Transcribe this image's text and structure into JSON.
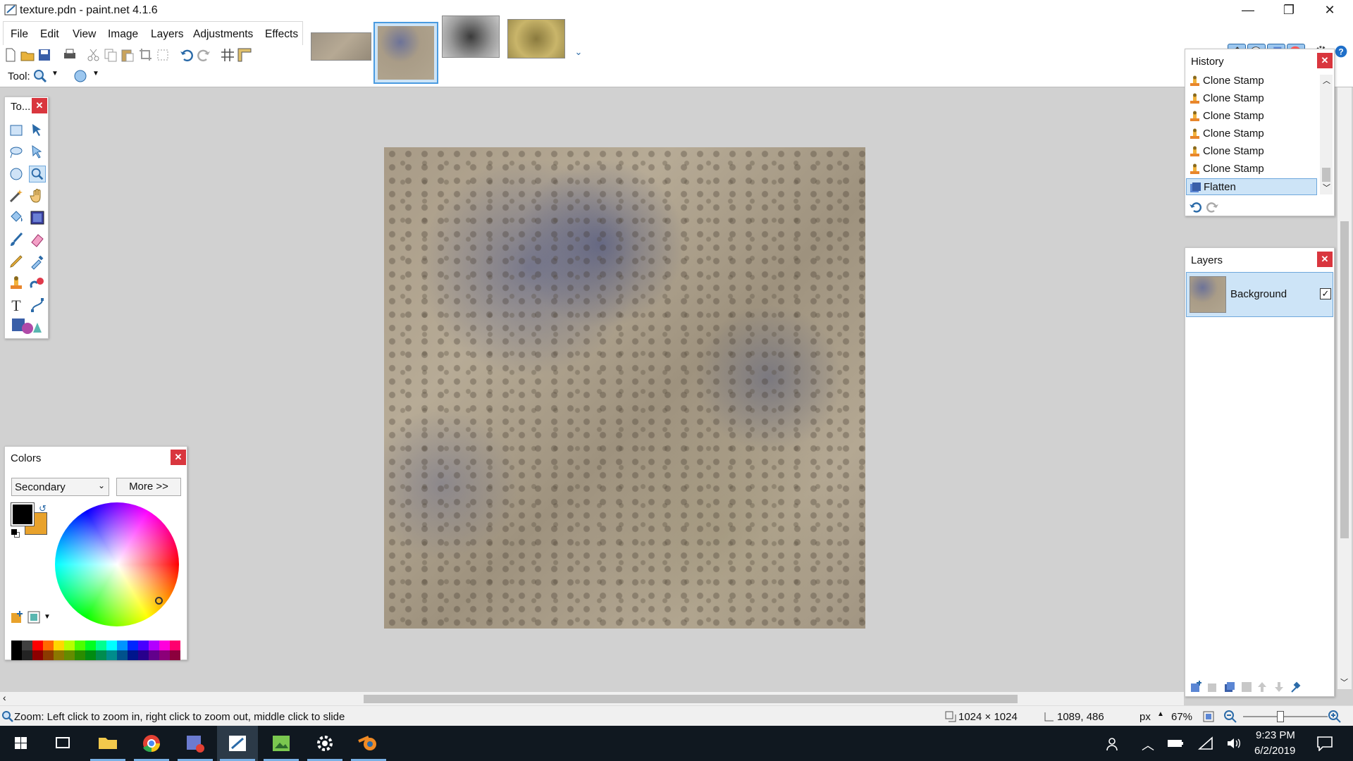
{
  "window": {
    "title": "texture.pdn - paint.net 4.1.6",
    "minimize_glyph": "—",
    "restore_glyph": "❐",
    "close_glyph": "✕"
  },
  "menu": [
    "File",
    "Edit",
    "View",
    "Image",
    "Layers",
    "Adjustments",
    "Effects"
  ],
  "toolbar": {
    "tool_label": "Tool:",
    "icons": [
      "new-icon",
      "open-icon",
      "save-icon",
      "print-icon",
      "cut-icon",
      "copy-icon",
      "paste-icon",
      "crop-icon",
      "deselect-icon",
      "undo-icon",
      "redo-icon",
      "grid-icon",
      "ruler-icon"
    ]
  },
  "image_tabs": [
    "texture-a",
    "texture-active",
    "texture-c",
    "texture-d"
  ],
  "tools_panel": {
    "title": "To...",
    "tools": [
      "rectangle-select",
      "move-selection",
      "lasso-select",
      "move-selected",
      "ellipse-select",
      "zoom",
      "magic-wand",
      "pan",
      "paint-bucket",
      "gradient",
      "paintbrush",
      "eraser",
      "pencil",
      "color-picker",
      "clone-stamp",
      "recolor",
      "text",
      "line-curve",
      "shapes"
    ]
  },
  "history_panel": {
    "title": "History",
    "items": [
      "Clone Stamp",
      "Clone Stamp",
      "Clone Stamp",
      "Clone Stamp",
      "Clone Stamp",
      "Clone Stamp",
      "Flatten"
    ],
    "selected_index": 6
  },
  "layers_panel": {
    "title": "Layers",
    "layers": [
      {
        "name": "Background",
        "visible": true
      }
    ]
  },
  "colors_panel": {
    "title": "Colors",
    "mode_select": "Secondary",
    "more_button": "More >>",
    "primary_color": "#000000",
    "secondary_color": "#e8a22c",
    "palette": [
      "#000000",
      "#404040",
      "#ff0000",
      "#ff6a00",
      "#ffd800",
      "#b6ff00",
      "#4cff00",
      "#00ff21",
      "#00ff90",
      "#00ffff",
      "#0094ff",
      "#0026ff",
      "#4800ff",
      "#b200ff",
      "#ff00dc",
      "#ff006e"
    ]
  },
  "statusbar": {
    "hint": "Zoom: Left click to zoom in, right click to zoom out, middle click to slide",
    "image_size": "1024 × 1024",
    "cursor_pos": "1089, 486",
    "units": "px",
    "zoom": "67%"
  },
  "taskbar": {
    "time": "9:23 PM",
    "date": "6/2/2019"
  }
}
